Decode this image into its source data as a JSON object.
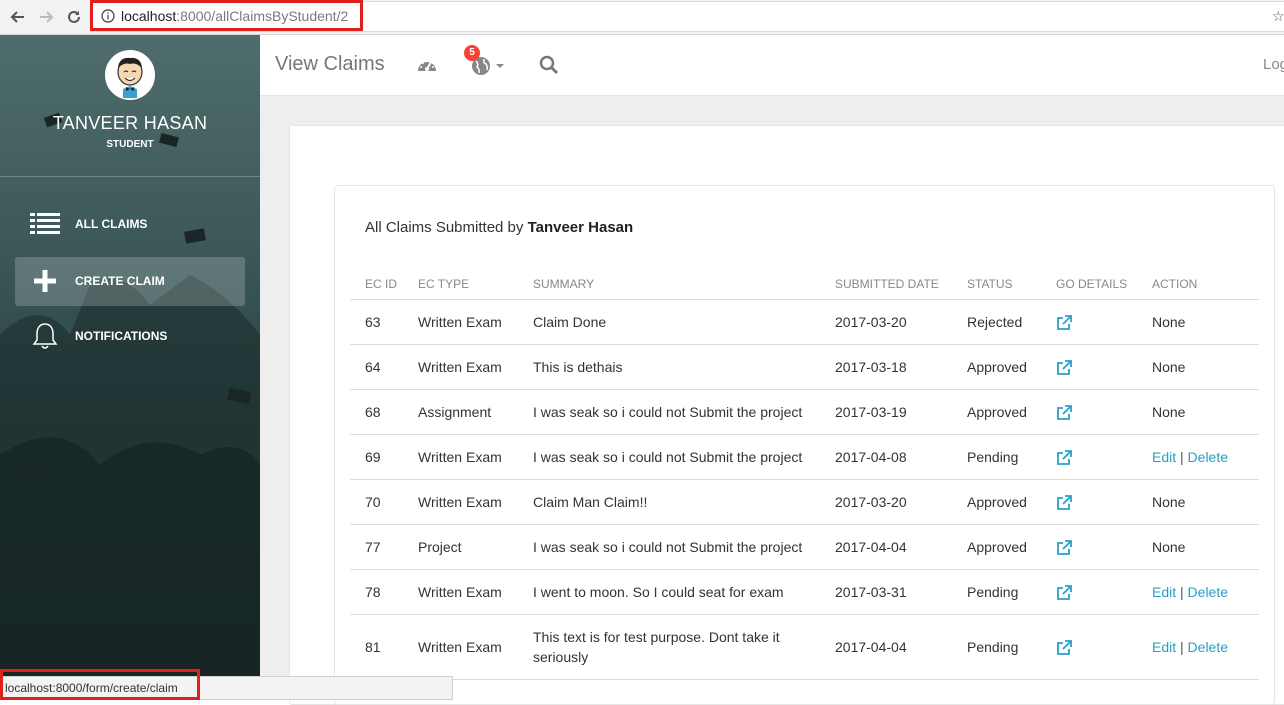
{
  "browser": {
    "url_host": "localhost",
    "url_path": ":8000/allClaimsByStudent/2",
    "status_url": "localhost:8000/form/create/claim"
  },
  "sidebar": {
    "user_name": "TANVEER HASAN",
    "user_role": "STUDENT",
    "items": [
      {
        "label": "ALL CLAIMS",
        "icon": "list-icon"
      },
      {
        "label": "CREATE CLAIM",
        "icon": "plus-icon",
        "active": true
      },
      {
        "label": "NOTIFICATIONS",
        "icon": "bell-icon"
      }
    ]
  },
  "topnav": {
    "title": "View Claims",
    "notification_count": "5",
    "logout_label": "Log"
  },
  "card": {
    "title_prefix": "All Claims Submitted by",
    "title_name": "Tanveer Hasan"
  },
  "table": {
    "headers": [
      "EC ID",
      "EC TYPE",
      "SUMMARY",
      "SUBMITTED DATE",
      "STATUS",
      "GO DETAILS",
      "ACTION"
    ],
    "rows": [
      {
        "id": "63",
        "type": "Written Exam",
        "summary": "Claim Done",
        "date": "2017-03-20",
        "status": "Rejected",
        "action": "None"
      },
      {
        "id": "64",
        "type": "Written Exam",
        "summary": "This is dethais",
        "date": "2017-03-18",
        "status": "Approved",
        "action": "None"
      },
      {
        "id": "68",
        "type": "Assignment",
        "summary": "I was seak so i could not Submit the project",
        "date": "2017-03-19",
        "status": "Approved",
        "action": "None"
      },
      {
        "id": "69",
        "type": "Written Exam",
        "summary": "I was seak so i could not Submit the project",
        "date": "2017-04-08",
        "status": "Pending",
        "edit": "Edit",
        "delete": "Delete"
      },
      {
        "id": "70",
        "type": "Written Exam",
        "summary": "Claim Man Claim!!",
        "date": "2017-03-20",
        "status": "Approved",
        "action": "None"
      },
      {
        "id": "77",
        "type": "Project",
        "summary": "I was seak so i could not Submit the project",
        "date": "2017-04-04",
        "status": "Approved",
        "action": "None"
      },
      {
        "id": "78",
        "type": "Written Exam",
        "summary": "I went to moon. So I could seat for exam",
        "date": "2017-03-31",
        "status": "Pending",
        "edit": "Edit",
        "delete": "Delete"
      },
      {
        "id": "81",
        "type": "Written Exam",
        "summary": "This text is for test purpose. Dont take it seriously",
        "date": "2017-04-04",
        "status": "Pending",
        "edit": "Edit",
        "delete": "Delete"
      }
    ],
    "action_separator": "|"
  },
  "colors": {
    "status_green": "#4caf50",
    "link_blue": "#26a0c7",
    "badge_red": "#f44336",
    "highlight_red": "#e0201c"
  }
}
